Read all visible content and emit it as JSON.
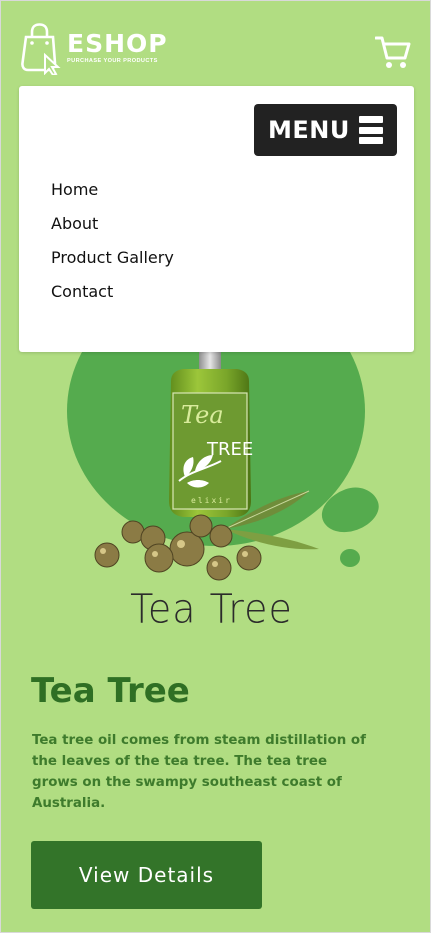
{
  "header": {
    "logo_title": "ESHOP",
    "logo_tagline": "PURCHASE YOUR PRODUCTS",
    "cart_icon": "shopping-cart-icon",
    "logo_icon": "shopping-bag-icon"
  },
  "menu": {
    "toggle_label": "MENU",
    "toggle_icon": "hamburger-icon",
    "items": [
      {
        "label": "Home"
      },
      {
        "label": "About"
      },
      {
        "label": "Product Gallery"
      },
      {
        "label": "Contact"
      }
    ]
  },
  "hero": {
    "bottle_label_line1": "Tea",
    "bottle_label_line2": "TREE",
    "bottle_label_line3": "elixir",
    "caption": "Tea Tree"
  },
  "product": {
    "title": "Tea Tree",
    "description": "Tea tree oil comes from steam distillation of the leaves of the tea tree. The tea tree grows on the swampy southeast coast of Australia.",
    "button_label": "View Details"
  },
  "colors": {
    "background": "#b1dd82",
    "accent_circle": "#55ab4e",
    "title_green": "#2f6f24",
    "button_green": "#337429",
    "menu_dark": "#222222"
  }
}
